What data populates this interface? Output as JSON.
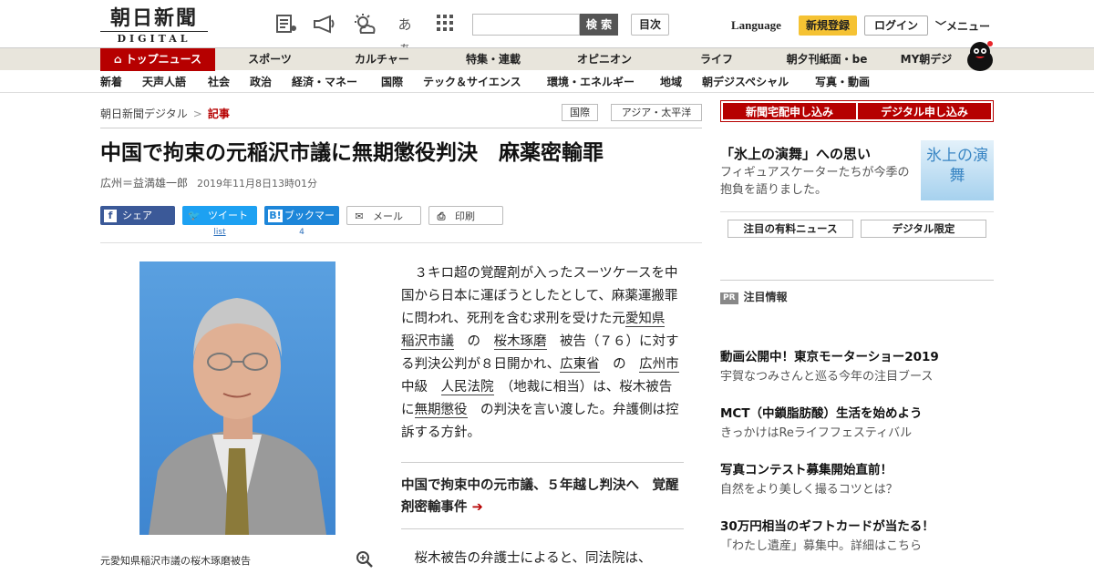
{
  "header": {
    "logo_kanji": "朝日新聞",
    "logo_sub": "DIGITAL",
    "search_button": "検 索",
    "toc_button": "目次",
    "language": "Language",
    "signup": "新規登録",
    "login": "ログイン",
    "menu": "メニュー",
    "icons": [
      "paper-icon",
      "megaphone-icon",
      "weather-icon",
      "font-size-icon",
      "grid-icon"
    ],
    "font_size_glyph": "あぁ"
  },
  "nav1": [
    "トップニュース",
    "スポーツ",
    "カルチャー",
    "特集・連載",
    "オピニオン",
    "ライフ",
    "朝夕刊紙面・be",
    "MY朝デジ"
  ],
  "nav2": [
    "新着",
    "天声人語",
    "社会",
    "政治",
    "経済・マネー",
    "国際",
    "テック＆サイエンス",
    "環境・エネルギー",
    "地域",
    "朝デジスペシャル",
    "写真・動画"
  ],
  "breadcrumb": {
    "site": "朝日新聞デジタル",
    "sep": ">",
    "current": "記事"
  },
  "tags": [
    "国際",
    "アジア・太平洋"
  ],
  "article": {
    "title": "中国で拘束の元稲沢市議に無期懲役判決　麻薬密輸罪",
    "author": "広州＝益満雄一郎",
    "date": "2019年11月8日13時01分",
    "photo_caption": "元愛知県稲沢市議の桜木琢磨被告",
    "lead_parts": [
      "３キロ超の覚醒剤が入ったスーツケースを中国から日本に運ぼうとしたとして、麻薬運搬罪に問われ、死刑を含む求刑を受けた元",
      "愛知県",
      "稲沢市議",
      "の",
      "桜木琢磨",
      "被告（７６）に対する判決公判が８日開かれ、",
      "広東省",
      "の",
      "広州市",
      "中級",
      "人民法院",
      "（地裁に相当）は、桜木被告に",
      "無期懲役",
      "の判決を言い渡した。弁護側は控訴する方針。"
    ],
    "related": "中国で拘束中の元市議、５年越し判決へ　覚醒剤密輸事件",
    "body2": "桜木被告の弁護士によると、同法院は、"
  },
  "share": {
    "facebook": "シェア",
    "twitter": "ツイート",
    "hatena": "ブックマーク",
    "mail": "メール",
    "print": "印刷",
    "twitter_count": "list",
    "hatena_count": "4"
  },
  "sidebar": {
    "subscribe": [
      "新聞宅配申し込み",
      "デジタル申し込み"
    ],
    "promo_title": "「氷上の演舞」への思い",
    "promo_desc": "フィギュアスケーターたちが今季の抱負を語りました。",
    "promo_img_text": "氷上の演舞",
    "buttons": [
      "注目の有料ニュース",
      "デジタル限定"
    ],
    "pr_badge": "PR",
    "pr_head": "注目情報",
    "pr_items": [
      {
        "title": "動画公開中！東京モーターショー2019",
        "desc": "宇賀なつみさんと巡る今年の注目ブース"
      },
      {
        "title": "MCT（中鎖脂肪酸）生活を始めよう",
        "desc": "きっかけはReライフフェスティバル"
      },
      {
        "title": "写真コンテスト募集開始直前！",
        "desc": "自然をより美しく撮るコツとは？"
      },
      {
        "title": "30万円相当のギフトカードが当たる！",
        "desc": "「わたし遺産」募集中。詳細はこちら"
      }
    ]
  },
  "colors": {
    "brand_red": "#b60000",
    "signup_yellow": "#f5c233",
    "facebook": "#3b5998",
    "twitter": "#1da1f2",
    "hatena": "#1d86d9"
  }
}
